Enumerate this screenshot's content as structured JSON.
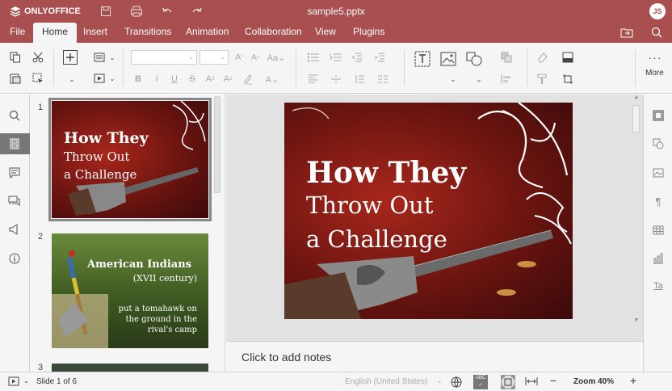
{
  "app": {
    "logo_text": "ONLYOFFICE",
    "doc_title": "sample5.pptx",
    "user_initials": "JS"
  },
  "menu": {
    "tabs": [
      "File",
      "Home",
      "Insert",
      "Transitions",
      "Animation",
      "Collaboration",
      "View",
      "Plugins"
    ],
    "active": "Home"
  },
  "toolbar": {
    "more_label": "More"
  },
  "slides": [
    {
      "number": "1",
      "title": "How They",
      "line2": "Throw Out",
      "line3": "a Challenge"
    },
    {
      "number": "2",
      "title": "American Indians",
      "subtitle": "(XVII century)",
      "body": [
        "put a tomahawk on",
        "the ground in the",
        "rival's camp"
      ]
    },
    {
      "number": "3"
    }
  ],
  "main_slide": {
    "title": "How They",
    "line2": "Throw Out",
    "line3": "a Challenge"
  },
  "notes": {
    "placeholder": "Click to add notes"
  },
  "status": {
    "slide_info": "Slide 1 of 6",
    "language": "English (United States)",
    "zoom": "Zoom 40%"
  },
  "colors": {
    "brand": "#aa4f4f",
    "slide_bg_dark": "#4a0f0f",
    "slide_bg_red": "#a8271c"
  }
}
